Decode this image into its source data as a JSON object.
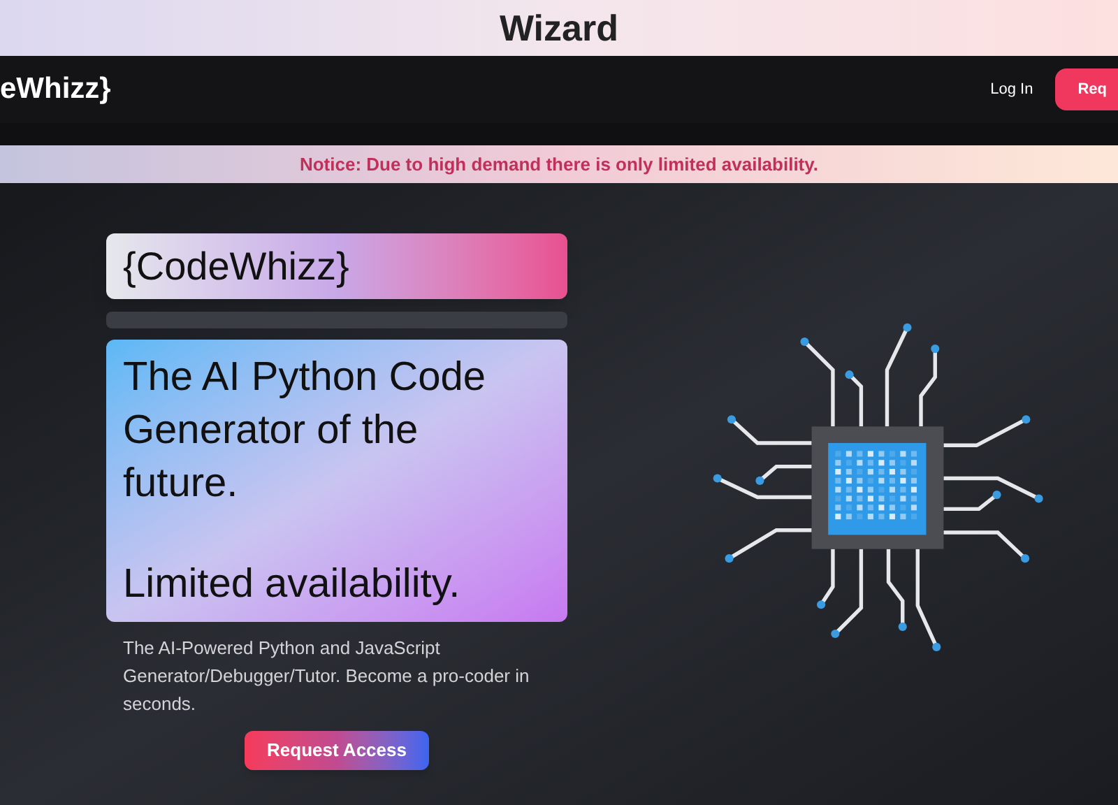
{
  "window": {
    "title": "Wizard"
  },
  "navbar": {
    "logo": "eWhizz}",
    "login": "Log In",
    "request": "Req"
  },
  "notice": "Notice: Due to high demand there is only limited availability.",
  "hero": {
    "logo": "{CodeWhizz}",
    "headline": [
      "The AI Python Code Generator of the future.",
      "Limited availability."
    ],
    "description": "The AI-Powered Python and JavaScript Generator/Debugger/Tutor. Become a pro-coder in seconds.",
    "button": "Request Access"
  }
}
